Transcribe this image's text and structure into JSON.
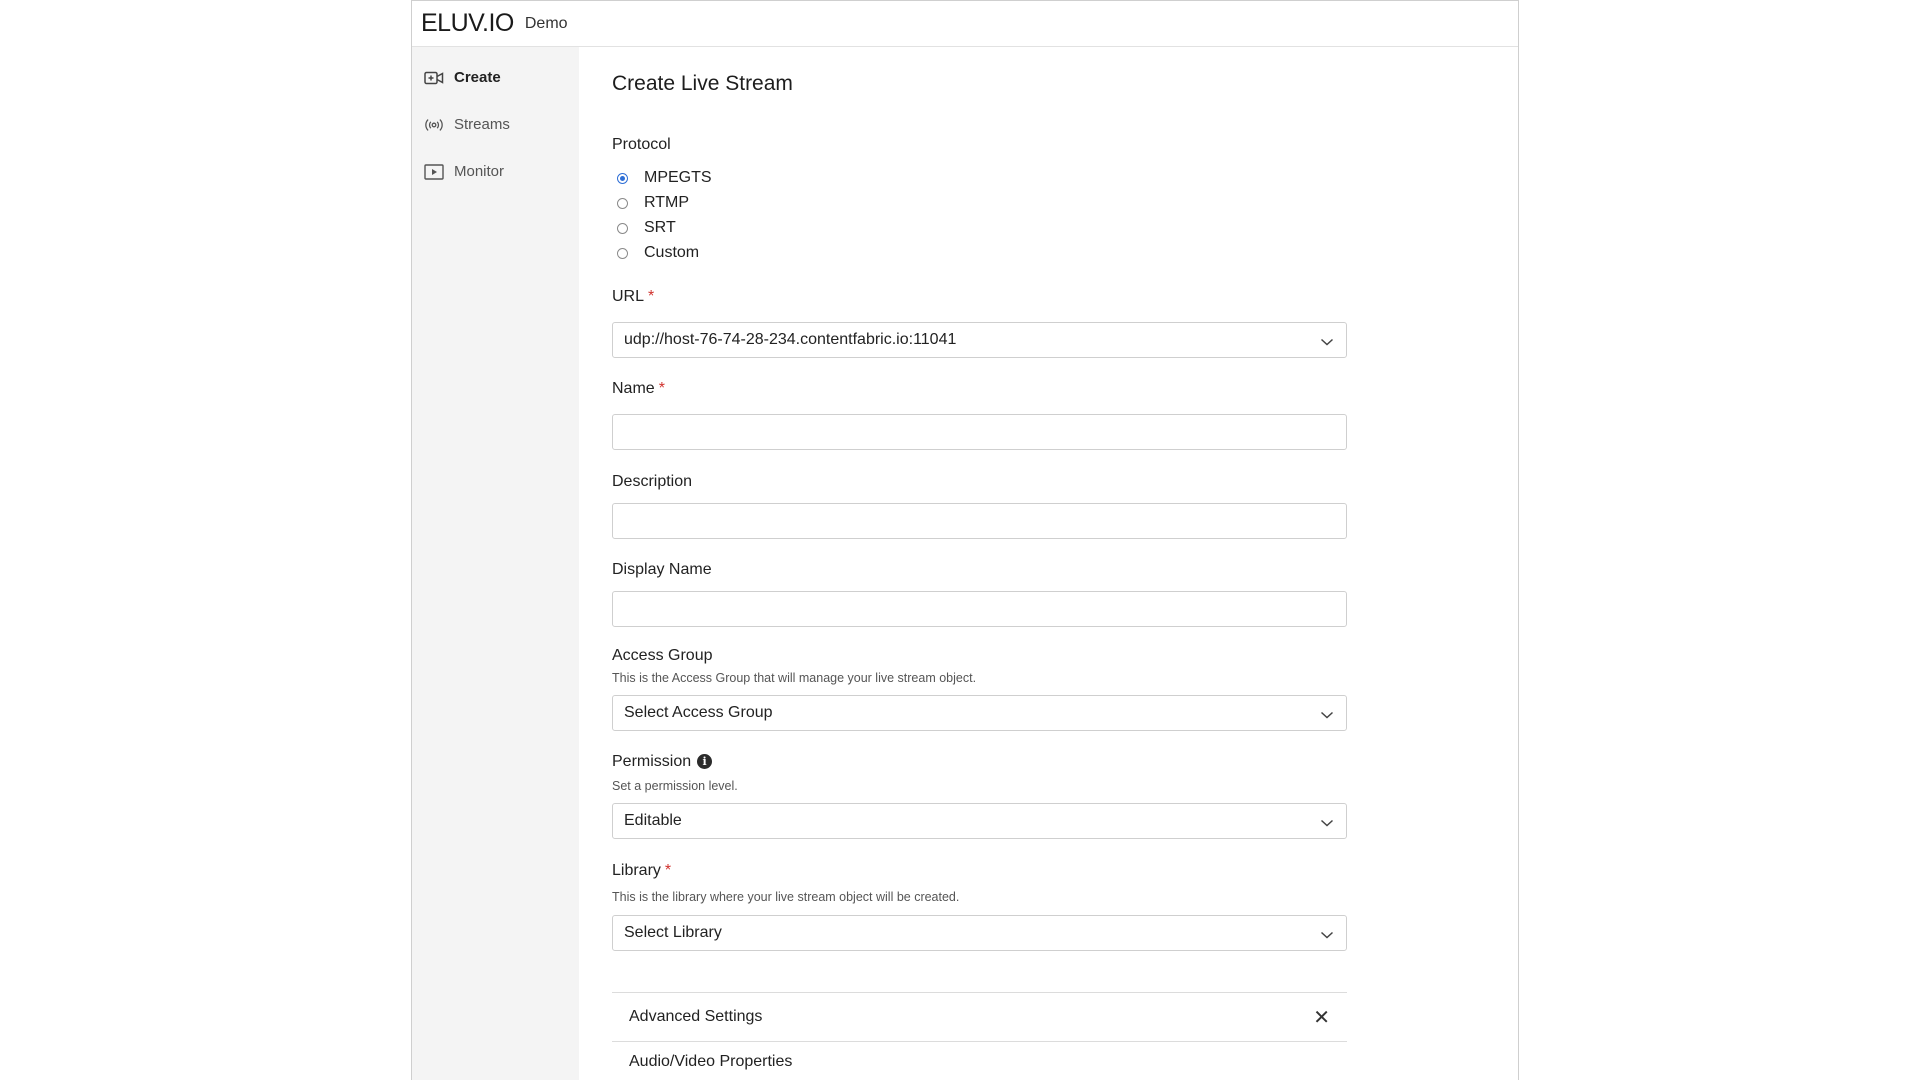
{
  "app": {
    "logo": "ELUV.IO",
    "environment": "Demo"
  },
  "sidebar": {
    "items": [
      {
        "label": "Create",
        "icon": "video-plus-icon",
        "active": true
      },
      {
        "label": "Streams",
        "icon": "broadcast-icon",
        "active": false
      },
      {
        "label": "Monitor",
        "icon": "play-box-icon",
        "active": false
      }
    ]
  },
  "form": {
    "title": "Create Live Stream",
    "protocol": {
      "label": "Protocol",
      "options": [
        "MPEGTS",
        "RTMP",
        "SRT",
        "Custom"
      ],
      "selected": "MPEGTS"
    },
    "url": {
      "label": "URL",
      "required_mark": "*",
      "value": "udp://host-76-74-28-234.contentfabric.io:11041"
    },
    "name": {
      "label": "Name",
      "required_mark": "*",
      "value": ""
    },
    "description": {
      "label": "Description",
      "value": ""
    },
    "display_name": {
      "label": "Display Name",
      "value": ""
    },
    "access_group": {
      "label": "Access Group",
      "help": "This is the Access Group that will manage your live stream object.",
      "value": "Select Access Group"
    },
    "permission": {
      "label": "Permission",
      "help": "Set a permission level.",
      "value": "Editable",
      "info_icon": "i"
    },
    "library": {
      "label": "Library",
      "required_mark": "*",
      "help": "This is the library where your live stream object will be created.",
      "value": "Select Library"
    },
    "advanced": {
      "label": "Advanced Settings",
      "close": "✕"
    },
    "av_properties": {
      "label": "Audio/Video Properties"
    }
  },
  "colors": {
    "accent": "#2f6fd6",
    "required": "#d0312d",
    "sidebar_bg": "#f4f4f4"
  }
}
